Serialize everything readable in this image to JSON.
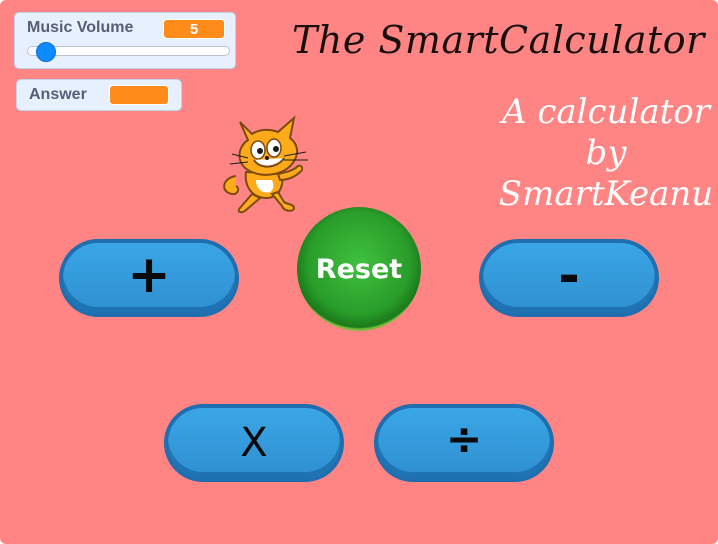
{
  "monitors": {
    "volume": {
      "label": "Music Volume",
      "value": "5",
      "slider_fraction": 0.05
    },
    "answer": {
      "label": "Answer",
      "value": ""
    }
  },
  "title": "The SmartCalculator",
  "subtitle_lines": [
    "A calculator",
    "by",
    "SmartKeanu"
  ],
  "buttons": {
    "add": "+",
    "subtract": "-",
    "multiply": "X",
    "divide": "÷",
    "reset": "Reset"
  },
  "colors": {
    "stage_bg": "#ff8585",
    "monitor_value": "#ff8c1a",
    "pill_blue": "#3aa6e6",
    "reset_green": "#2a9d2a"
  }
}
